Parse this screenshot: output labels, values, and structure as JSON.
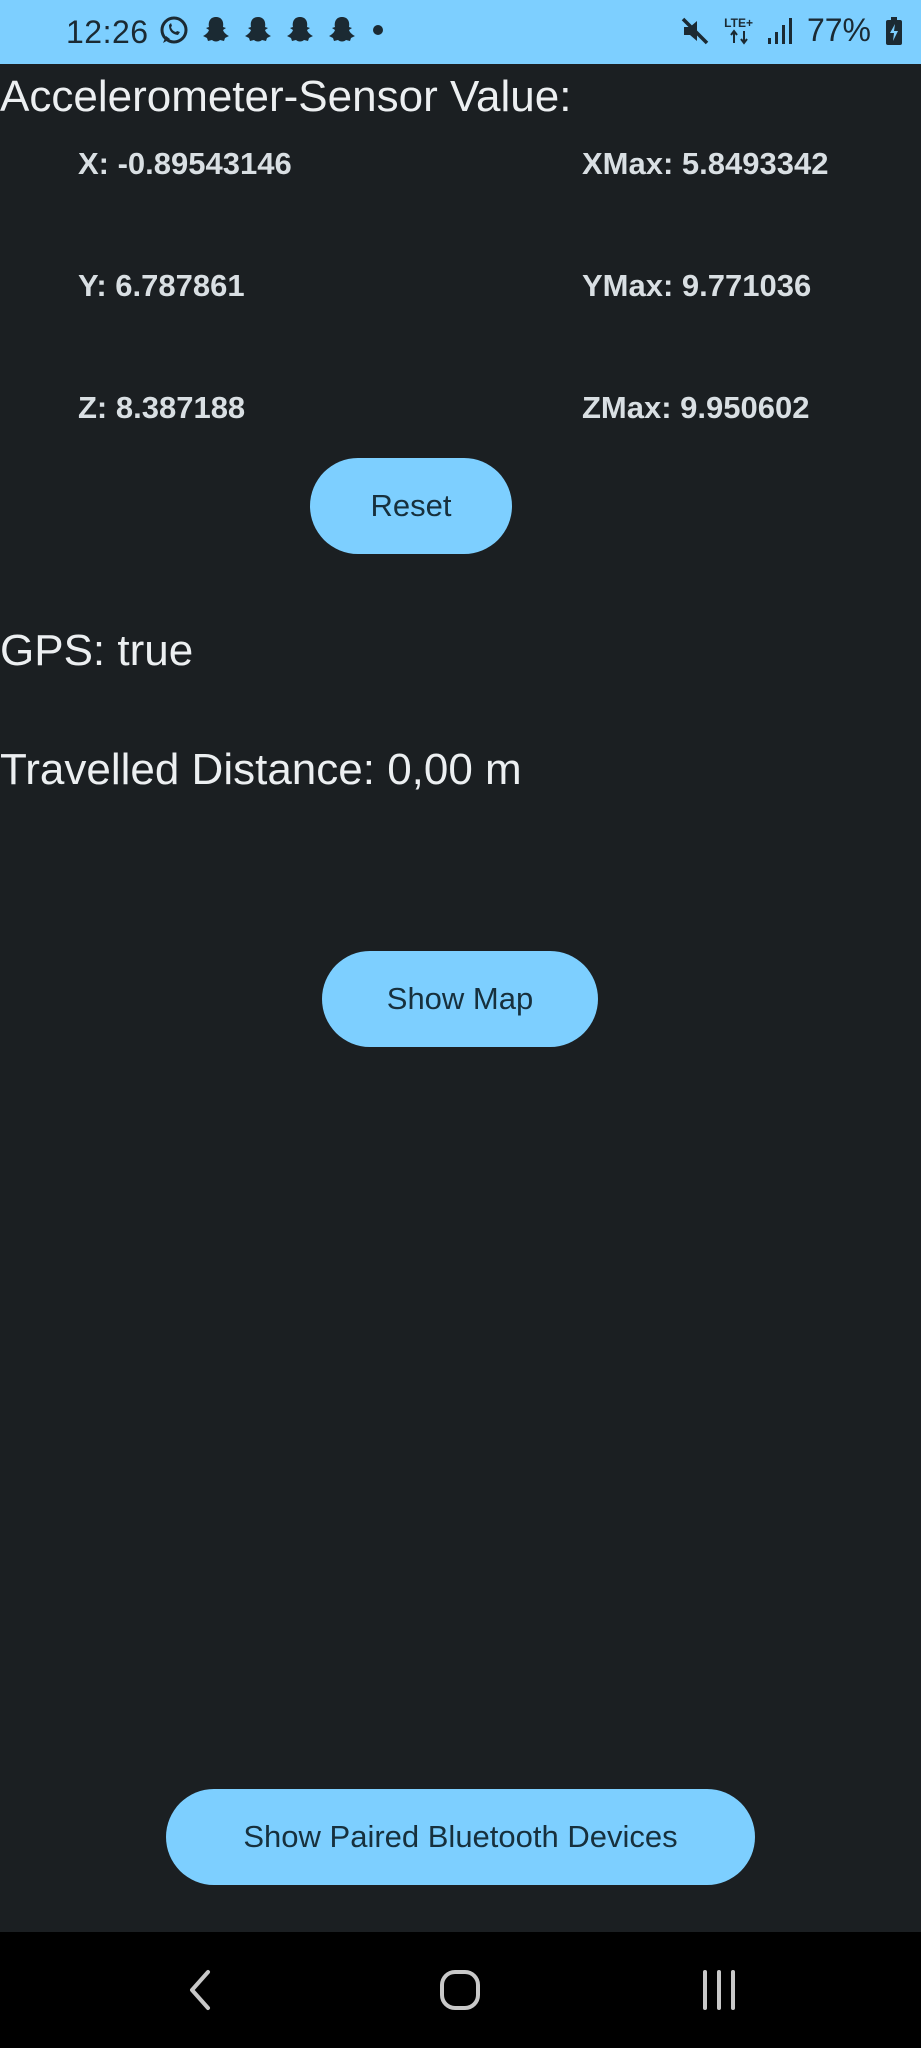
{
  "status_bar": {
    "time": "12:26",
    "left_icons": [
      "whatsapp-icon",
      "snapchat-icon",
      "snapchat-icon",
      "snapchat-icon",
      "snapchat-icon",
      "dot-icon"
    ],
    "network_label": "LTE+",
    "battery_percent": "77%",
    "background_color": "#7dcfff"
  },
  "sensor": {
    "title": "Accelerometer-Sensor Value:",
    "x": "X: -0.89543146",
    "y": "Y: 6.787861",
    "z": "Z: 8.387188",
    "xmax": "XMax: 5.8493342",
    "ymax": "YMax: 9.771036",
    "zmax": "ZMax: 9.950602"
  },
  "buttons": {
    "reset": "Reset",
    "show_map": "Show Map",
    "show_bluetooth": "Show Paired Bluetooth Devices",
    "accent_color": "#7dcfff"
  },
  "gps": {
    "status": "GPS: true"
  },
  "distance": {
    "text": "Travelled Distance: 0,00 m"
  },
  "nav_bar": {
    "buttons": [
      "back-icon",
      "home-icon",
      "recents-icon"
    ]
  }
}
